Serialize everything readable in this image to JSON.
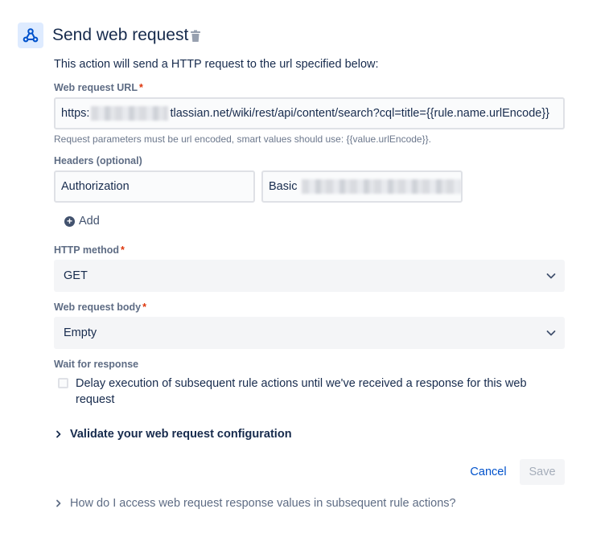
{
  "header": {
    "title": "Send web request",
    "icon": "webhook-icon",
    "delete_icon": "trash-icon"
  },
  "description": "This action will send a HTTP request to the url specified below:",
  "url_field": {
    "label": "Web request URL",
    "required_mark": "*",
    "value_prefix": "https:",
    "value_suffix": "tlassian.net/wiki/rest/api/content/search?cql=title={{rule.name.urlEncode}}",
    "hint": "Request parameters must be url encoded, smart values should use: {{value.urlEncode}}."
  },
  "headers": {
    "label": "Headers (optional)",
    "name_value": "Authorization",
    "value_prefix": "Basic",
    "add_label": "Add"
  },
  "http_method": {
    "label": "HTTP method",
    "required_mark": "*",
    "selected": "GET"
  },
  "request_body": {
    "label": "Web request body",
    "required_mark": "*",
    "selected": "Empty"
  },
  "wait": {
    "label": "Wait for response",
    "checkbox_label": "Delay execution of subsequent rule actions until we've received a response for this web request",
    "checked": false
  },
  "validate_label": "Validate your web request configuration",
  "buttons": {
    "cancel": "Cancel",
    "save": "Save"
  },
  "help_label": "How do I access web request response values in subsequent rule actions?",
  "colors": {
    "primary": "#0052cc",
    "text": "#172b4d",
    "required": "#de350b"
  }
}
